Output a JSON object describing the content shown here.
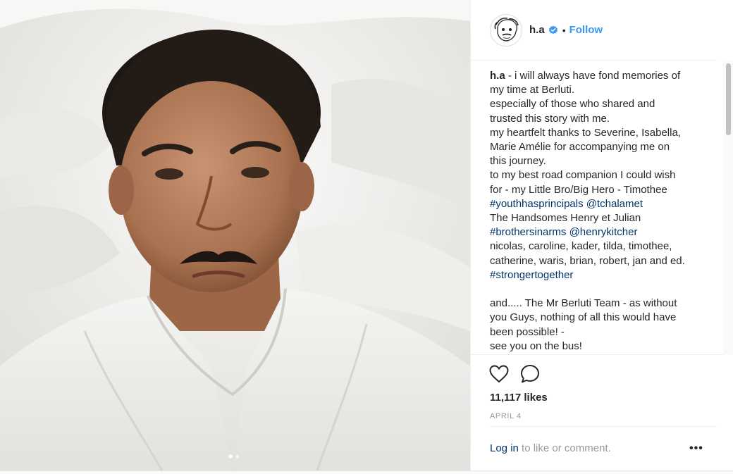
{
  "post": {
    "author": {
      "username": "h.a",
      "verified": true,
      "separator": "•",
      "follow_label": "Follow"
    },
    "photo": {
      "carousel": {
        "count": 2,
        "active_index": 1
      }
    },
    "caption": {
      "author": "h.a",
      "lines": [
        {
          "text": " - i will always have fond memories of"
        },
        {
          "text": "my time at Berluti."
        },
        {
          "text": "especially of those who shared and"
        },
        {
          "text": "trusted this story with me."
        },
        {
          "text": "my heartfelt thanks to Severine, Isabella,"
        },
        {
          "text": "Marie Amélie for accompanying me on"
        },
        {
          "text": "this journey."
        },
        {
          "text": "to my best road companion I could wish"
        },
        {
          "text": "for - my Little Bro/Big Hero - Timothee"
        },
        {
          "tags": [
            "#youthhasprincipals",
            "@tchalamet"
          ]
        },
        {
          "text": "The Handsomes Henry et Julian"
        },
        {
          "tags": [
            "#brothersinarms",
            "@henrykitcher"
          ]
        },
        {
          "text": "nicolas, caroline, kader, tilda, timothee,"
        },
        {
          "text": "catherine, waris, brian, robert, jan and ed."
        },
        {
          "tags": [
            "#strongertogether"
          ]
        },
        {
          "text": ""
        },
        {
          "text": "and..... The Mr Berluti Team - as without"
        },
        {
          "text": "you Guys, nothing of all this would have"
        },
        {
          "text": "been possible! -"
        },
        {
          "text": "see you on the bus!"
        }
      ]
    },
    "actions": {
      "like_icon": "heart-icon",
      "comment_icon": "comment-icon"
    },
    "likes_text": "11,117 likes",
    "date_text": "APRIL 4",
    "comment_prompt": {
      "login_label": "Log in",
      "rest_label": " to like or comment.",
      "more_label": "•••"
    }
  },
  "colors": {
    "accent": "#3897f0",
    "link": "#003569",
    "text": "#262626",
    "muted": "#999999",
    "border": "#efefef"
  }
}
